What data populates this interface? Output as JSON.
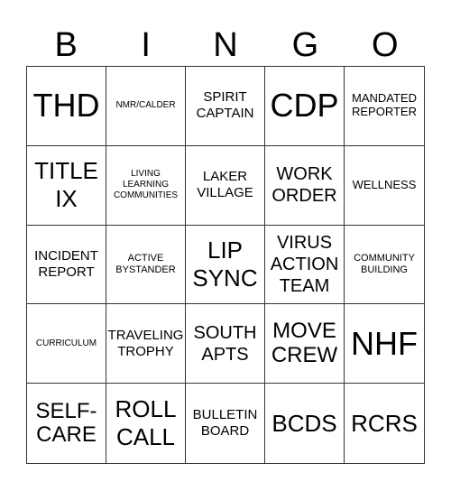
{
  "header": [
    "B",
    "I",
    "N",
    "G",
    "O"
  ],
  "cells": [
    [
      "THD",
      "NMR/CALDER",
      "SPIRIT CAPTAIN",
      "CDP",
      "MANDATED REPORTER"
    ],
    [
      "TITLE IX",
      "LIVING LEARNING COMMUNITIES",
      "LAKER VILLAGE",
      "WORK ORDER",
      "WELLNESS"
    ],
    [
      "INCIDENT REPORT",
      "ACTIVE BYSTANDER",
      "LIP SYNC",
      "VIRUS ACTION TEAM",
      "COMMUNITY BUILDING"
    ],
    [
      "CURRICULUM",
      "TRAVELING TROPHY",
      "SOUTH APTS",
      "MOVE CREW",
      "NHF"
    ],
    [
      "SELF-CARE",
      "ROLL CALL",
      "BULLETIN BOARD",
      "BCDS",
      "RCRS"
    ]
  ]
}
